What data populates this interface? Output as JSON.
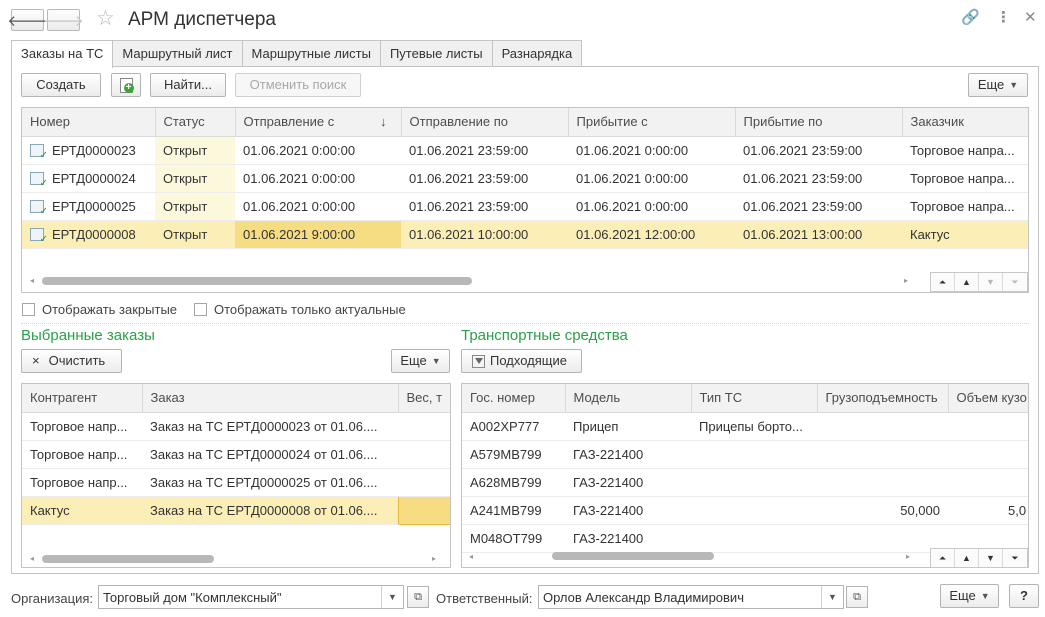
{
  "window": {
    "title": "АРМ диспетчера",
    "back_icon": "arrow-left-icon",
    "forward_icon": "arrow-right-icon",
    "link_icon": "link-icon",
    "menu_icon": "more-vertical-icon",
    "close_icon": "close-icon"
  },
  "tabs": [
    {
      "label": "Заказы на ТС",
      "active": true
    },
    {
      "label": "Маршрутный лист"
    },
    {
      "label": "Маршрутные листы"
    },
    {
      "label": "Путевые листы"
    },
    {
      "label": "Разнарядка"
    }
  ],
  "toolbar": {
    "create": "Создать",
    "find": "Найти...",
    "cancel_search": "Отменить поиск",
    "more": "Еще"
  },
  "orders": {
    "columns": [
      "Номер",
      "Статус",
      "Отправление с",
      "Отправление по",
      "Прибытие с",
      "Прибытие по",
      "Заказчик"
    ],
    "sort_indicator": "↓",
    "rows": [
      {
        "number": "ЕРТД0000023",
        "status": "Открыт",
        "dep_from": "01.06.2021 0:00:00",
        "dep_to": "01.06.2021 23:59:00",
        "arr_from": "01.06.2021 0:00:00",
        "arr_to": "01.06.2021 23:59:00",
        "customer": "Торговое напра..."
      },
      {
        "number": "ЕРТД0000024",
        "status": "Открыт",
        "dep_from": "01.06.2021 0:00:00",
        "dep_to": "01.06.2021 23:59:00",
        "arr_from": "01.06.2021 0:00:00",
        "arr_to": "01.06.2021 23:59:00",
        "customer": "Торговое напра..."
      },
      {
        "number": "ЕРТД0000025",
        "status": "Открыт",
        "dep_from": "01.06.2021 0:00:00",
        "dep_to": "01.06.2021 23:59:00",
        "arr_from": "01.06.2021 0:00:00",
        "arr_to": "01.06.2021 23:59:00",
        "customer": "Торговое напра..."
      },
      {
        "number": "ЕРТД0000008",
        "status": "Открыт",
        "dep_from": "01.06.2021 9:00:00",
        "dep_to": "01.06.2021 10:00:00",
        "arr_from": "01.06.2021 12:00:00",
        "arr_to": "01.06.2021 13:00:00",
        "customer": "Кактус",
        "selected": true
      }
    ]
  },
  "filters": {
    "show_closed": "Отображать закрытые",
    "show_actual_only": "Отображать только актуальные"
  },
  "selected_orders": {
    "title": "Выбранные заказы",
    "clear": "Очистить",
    "clear_icon": "×",
    "more": "Еще",
    "columns": [
      "Контрагент",
      "Заказ",
      "Вес, т"
    ],
    "rows": [
      {
        "counterparty": "Торговое напр...",
        "order": "Заказ на ТС ЕРТД0000023 от 01.06....",
        "weight": ""
      },
      {
        "counterparty": "Торговое напр...",
        "order": "Заказ на ТС ЕРТД0000024 от 01.06....",
        "weight": ""
      },
      {
        "counterparty": "Торговое напр...",
        "order": "Заказ на ТС ЕРТД0000025 от 01.06....",
        "weight": ""
      },
      {
        "counterparty": "Кактус",
        "order": "Заказ на ТС ЕРТД0000008 от 01.06....",
        "weight": "",
        "selected": true
      }
    ]
  },
  "vehicles": {
    "title": "Транспортные средства",
    "suitable": "Подходящие",
    "columns": [
      "Гос. номер",
      "Модель",
      "Тип ТС",
      "Грузоподъемность",
      "Объем кузо"
    ],
    "rows": [
      {
        "plate": "А002ХР777",
        "model": "Прицеп",
        "type": "Прицепы борто...",
        "capacity": "",
        "volume": ""
      },
      {
        "plate": "А579МВ799",
        "model": "ГАЗ-221400",
        "type": "",
        "capacity": "",
        "volume": ""
      },
      {
        "plate": "А628МВ799",
        "model": "ГАЗ-221400",
        "type": "",
        "capacity": "",
        "volume": ""
      },
      {
        "plate": "А241МВ799",
        "model": "ГАЗ-221400",
        "type": "",
        "capacity": "50,000",
        "volume": "5,0"
      },
      {
        "plate": "М048ОТ799",
        "model": "ГАЗ-221400",
        "type": "",
        "capacity": "",
        "volume": ""
      }
    ]
  },
  "footer": {
    "org_label": "Организация:",
    "org_value": "Торговый дом \"Комплексный\"",
    "resp_label": "Ответственный:",
    "resp_value": "Орлов Александр Владимирович",
    "more": "Еще",
    "help": "?"
  }
}
